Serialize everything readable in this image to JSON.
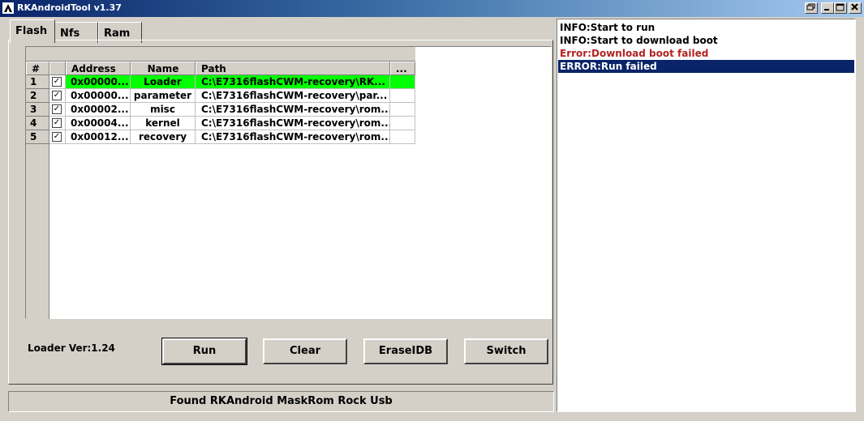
{
  "window": {
    "title": "RKAndroidTool v1.37",
    "controls": [
      "restore-icon",
      "minimize-icon",
      "maximize-icon",
      "close-icon"
    ]
  },
  "tabs": [
    {
      "label": "Flash",
      "active": true
    },
    {
      "label": "Nfs",
      "active": false
    },
    {
      "label": "Ram",
      "active": false
    }
  ],
  "table": {
    "columns": [
      "#",
      "",
      "Address",
      "Name",
      "Path",
      "..."
    ],
    "rows": [
      {
        "num": "1",
        "checked": true,
        "address": "0x00000...",
        "name": "Loader",
        "path": "C:\\E7316flashCWM-recovery\\RK...",
        "more": "",
        "selected": true
      },
      {
        "num": "2",
        "checked": true,
        "address": "0x00000...",
        "name": "parameter",
        "path": "C:\\E7316flashCWM-recovery\\par...",
        "more": ""
      },
      {
        "num": "3",
        "checked": true,
        "address": "0x00002...",
        "name": "misc",
        "path": "C:\\E7316flashCWM-recovery\\rom...",
        "more": ""
      },
      {
        "num": "4",
        "checked": true,
        "address": "0x00004...",
        "name": "kernel",
        "path": "C:\\E7316flashCWM-recovery\\rom...",
        "more": ""
      },
      {
        "num": "5",
        "checked": true,
        "address": "0x00012...",
        "name": "recovery",
        "path": "C:\\E7316flashCWM-recovery\\rom...",
        "more": ""
      }
    ],
    "selected_row_color": "#00ff00"
  },
  "loader_ver": "Loader Ver:1.24",
  "buttons": {
    "run": "Run",
    "clear": "Clear",
    "erase_idb": "EraseIDB",
    "switch": "Switch"
  },
  "status": "Found RKAndroid MaskRom Rock Usb",
  "log": [
    {
      "text": "INFO:Start to run",
      "type": "info"
    },
    {
      "text": "INFO:Start to download boot",
      "type": "info"
    },
    {
      "text": "Error:Download boot failed",
      "type": "error"
    },
    {
      "text": "ERROR:Run failed",
      "type": "selected"
    }
  ],
  "colors": {
    "titlebar_start": "#0a246a",
    "titlebar_end": "#a6caf0",
    "error_text": "#b22222",
    "log_selection": "#0a246a",
    "window_face": "#d4d0c8"
  }
}
